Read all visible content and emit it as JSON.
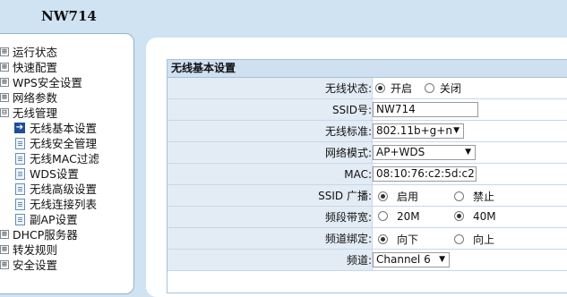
{
  "brand": "NW714",
  "sidebar": {
    "items": [
      {
        "label": "运行状态",
        "marker": "⊞"
      },
      {
        "label": "快速配置",
        "marker": "⊞"
      },
      {
        "label": "WPS安全设置",
        "marker": "⊞"
      },
      {
        "label": "网络参数",
        "marker": "⊞"
      },
      {
        "label": "无线管理",
        "marker": "⊟"
      },
      {
        "label": "无线基本设置"
      },
      {
        "label": "无线安全管理"
      },
      {
        "label": "无线MAC过滤"
      },
      {
        "label": "WDS设置"
      },
      {
        "label": "无线高级设置"
      },
      {
        "label": "无线连接列表"
      },
      {
        "label": "副AP设置"
      },
      {
        "label": "DHCP服务器",
        "marker": "⊞"
      },
      {
        "label": "转发规则",
        "marker": "⊞"
      },
      {
        "label": "安全设置",
        "marker": "⊞"
      }
    ]
  },
  "panel": {
    "title": "无线基本设置",
    "rows": {
      "wireless_status": {
        "label": "无线状态:",
        "opt_on": "开启",
        "opt_off": "关闭",
        "selected": "开启"
      },
      "ssid": {
        "label": "SSID号:",
        "value": "NW714"
      },
      "standard": {
        "label": "无线标准:",
        "value": "802.11b+g+n"
      },
      "network_mode": {
        "label": "网络模式:",
        "value": "AP+WDS"
      },
      "mac": {
        "label": "MAC:",
        "value": "08:10:76:c2:5d:c2"
      },
      "ssid_broadcast": {
        "label": "SSID 广播:",
        "opt_on": "启用",
        "opt_off": "禁止",
        "selected": "启用"
      },
      "bandwidth": {
        "label": "频段带宽:",
        "opt_a": "20M",
        "opt_b": "40M",
        "selected": "40M"
      },
      "channel_bind": {
        "label": "频道绑定:",
        "opt_a": "向下",
        "opt_b": "向上",
        "selected": "向下"
      },
      "channel": {
        "label": "频道:",
        "value": "Channel 6"
      }
    }
  }
}
